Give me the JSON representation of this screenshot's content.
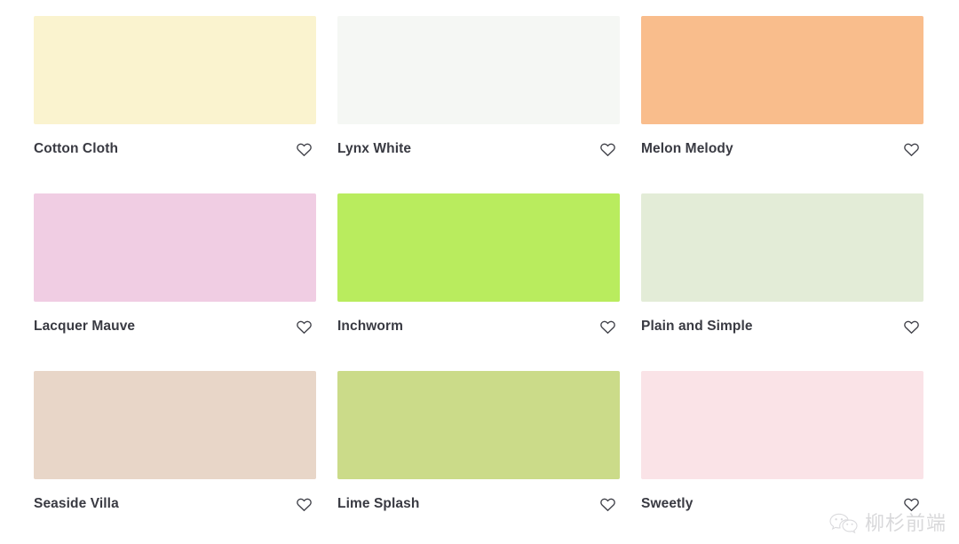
{
  "page": {
    "background": "#ffffff",
    "title": "Paint Colour Palette Grid",
    "text_color": "#393a42",
    "icon_color": "#3d3e46"
  },
  "grid": {
    "columns": 3,
    "rows": 3,
    "swatches": [
      {
        "name": "Cotton Cloth",
        "color": "#faf3cf",
        "favorite_icon": "heart-outline-icon",
        "favorited": false
      },
      {
        "name": "Lynx White",
        "color": "#f5f7f4",
        "favorite_icon": "heart-outline-icon",
        "favorited": false
      },
      {
        "name": "Melon Melody",
        "color": "#f9bd8c",
        "favorite_icon": "heart-outline-icon",
        "favorited": false
      },
      {
        "name": "Lacquer Mauve",
        "color": "#f0cde3",
        "favorite_icon": "heart-outline-icon",
        "favorited": false
      },
      {
        "name": "Inchworm",
        "color": "#b9ec5e",
        "favorite_icon": "heart-outline-icon",
        "favorited": false
      },
      {
        "name": "Plain and Simple",
        "color": "#e3ecd7",
        "favorite_icon": "heart-outline-icon",
        "favorited": false
      },
      {
        "name": "Seaside Villa",
        "color": "#e8d6c8",
        "favorite_icon": "heart-outline-icon",
        "favorited": false
      },
      {
        "name": "Lime Splash",
        "color": "#cbdb89",
        "favorite_icon": "heart-outline-icon",
        "favorited": false
      },
      {
        "name": "Sweetly",
        "color": "#fae3e7",
        "favorite_icon": "heart-outline-icon",
        "favorited": false
      }
    ]
  },
  "watermark": {
    "logo_icon": "wechat-logo-icon",
    "text": "柳杉前端"
  }
}
